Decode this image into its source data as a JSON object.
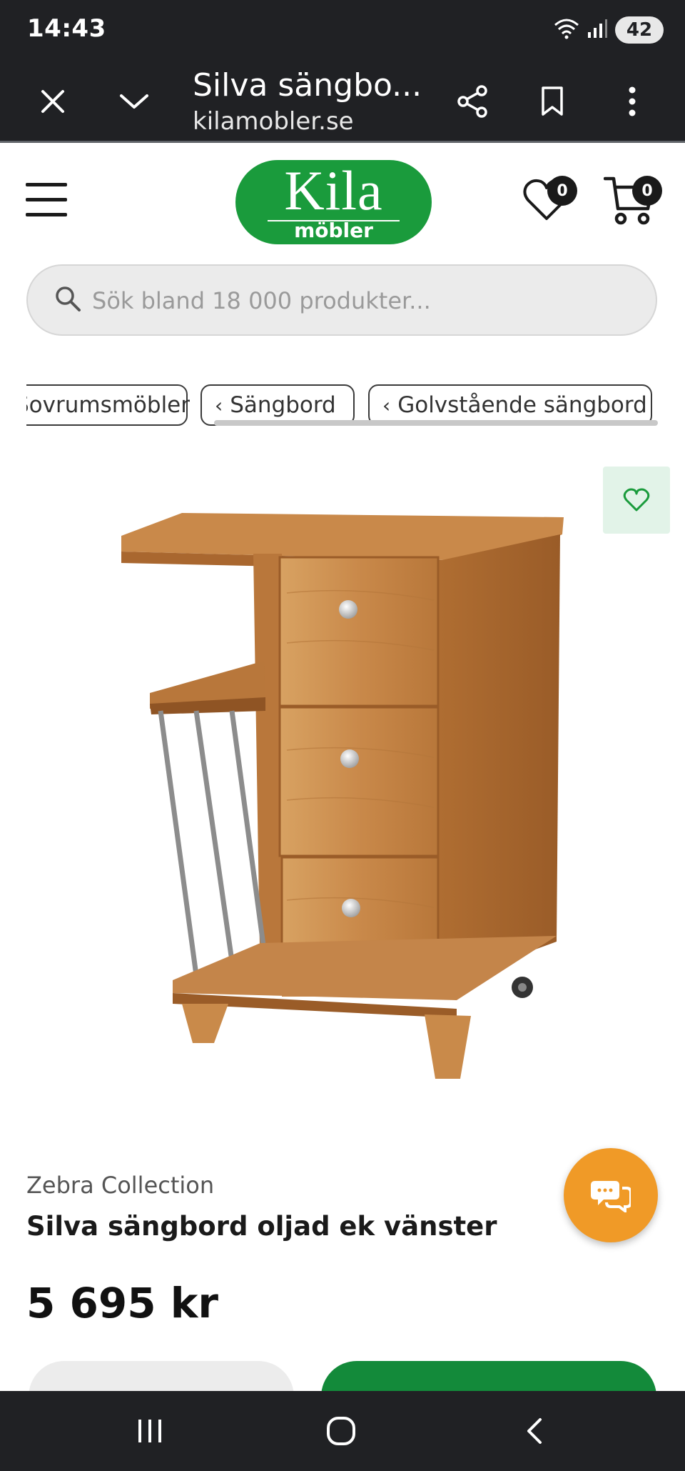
{
  "status_bar": {
    "time": "14:43",
    "battery": "42",
    "icons": [
      "wifi-icon",
      "signal-icon",
      "battery-icon"
    ]
  },
  "browser": {
    "title": "Silva sängbo...",
    "url": "kilamobler.se",
    "icons": [
      "close-icon",
      "chevron-down-icon",
      "share-icon",
      "bookmark-icon",
      "more-vert-icon"
    ]
  },
  "header": {
    "logo_main": "Kila",
    "logo_sub": "möbler",
    "favorites_count": "0",
    "cart_count": "0"
  },
  "search": {
    "placeholder": "Sök bland 18 000 produkter..."
  },
  "breadcrumbs": [
    {
      "label": "Sovrumsmöbler"
    },
    {
      "label": "Sängbord"
    },
    {
      "label": "Golvstående sängbord"
    }
  ],
  "product": {
    "brand": "Zebra Collection",
    "title": "Silva sängbord oljad ek vänster",
    "price": "5 695 kr"
  },
  "colors": {
    "brand_green": "#1a9b3c",
    "chat_orange": "#f09a27",
    "favorite_bg": "#e2f3e8",
    "system_dark": "#202124"
  }
}
